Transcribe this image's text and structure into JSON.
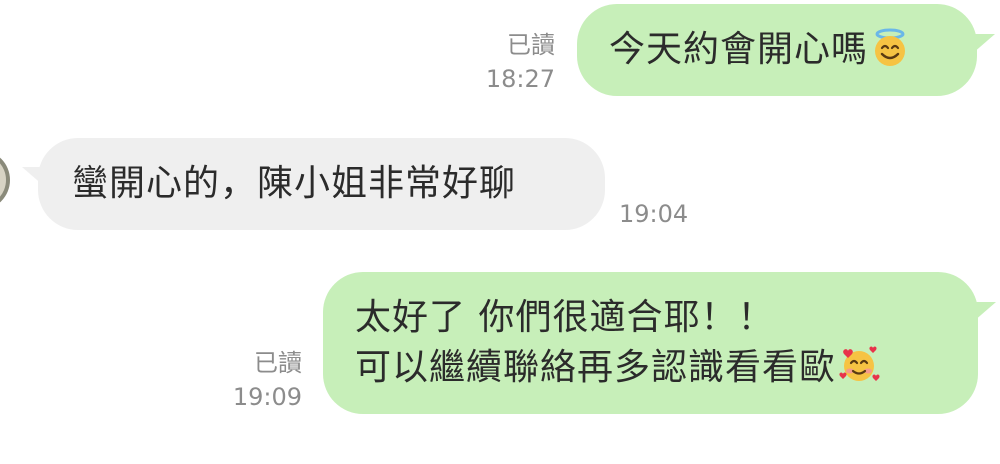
{
  "messages": [
    {
      "direction": "outgoing",
      "lines": [
        "今天約會開心嗎"
      ],
      "emoji": "smiling-face-with-halo",
      "read_label": "已讀",
      "time": "18:27"
    },
    {
      "direction": "incoming",
      "lines": [
        "蠻開心的，陳小姐非常好聊"
      ],
      "time": "19:04"
    },
    {
      "direction": "outgoing",
      "lines": [
        "太好了 你們很適合耶！！",
        "可以繼續聯絡再多認識看看歐"
      ],
      "emoji": "smiling-face-with-hearts",
      "read_label": "已讀",
      "time": "19:09"
    }
  ],
  "colors": {
    "outgoing_bubble": "#c7efb9",
    "incoming_bubble": "#efefef",
    "text": "#2b2b2b",
    "meta": "#8c8c8c",
    "background": "#ffffff"
  }
}
